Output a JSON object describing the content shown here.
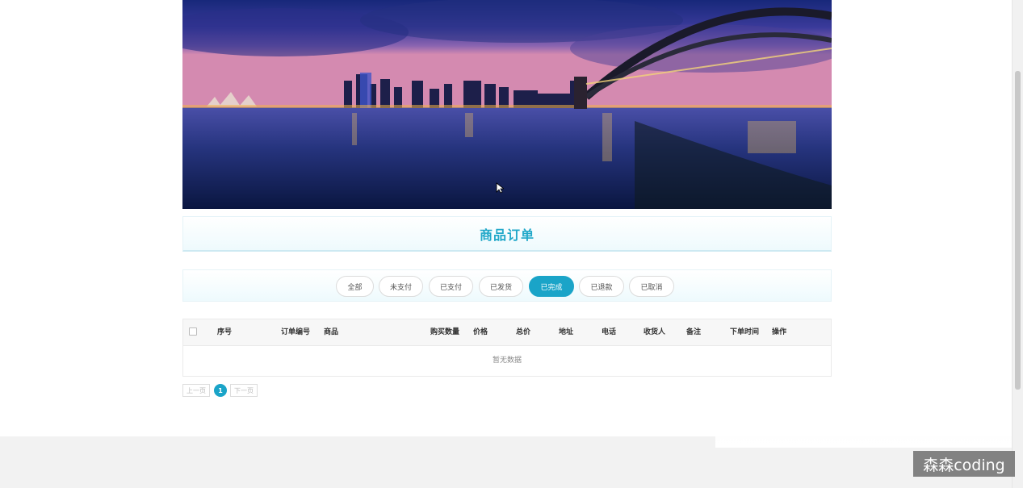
{
  "banner": {
    "alt": "city harbour night skyline"
  },
  "page_title": "商品订单",
  "tabs": [
    {
      "label": "全部",
      "active": false
    },
    {
      "label": "未支付",
      "active": false
    },
    {
      "label": "已支付",
      "active": false
    },
    {
      "label": "已发货",
      "active": false
    },
    {
      "label": "已完成",
      "active": true
    },
    {
      "label": "已退款",
      "active": false
    },
    {
      "label": "已取消",
      "active": false
    }
  ],
  "table": {
    "columns": [
      "序号",
      "订单编号",
      "商品",
      "购买数量",
      "价格",
      "总价",
      "地址",
      "电话",
      "收货人",
      "备注",
      "下单时间",
      "操作"
    ],
    "empty_text": "暂无数据"
  },
  "pagination": {
    "prev": "上一页",
    "current": "1",
    "next": "下一页"
  },
  "watermark": "森森coding",
  "colors": {
    "accent": "#1aa4c8",
    "title": "#22a8c9"
  }
}
